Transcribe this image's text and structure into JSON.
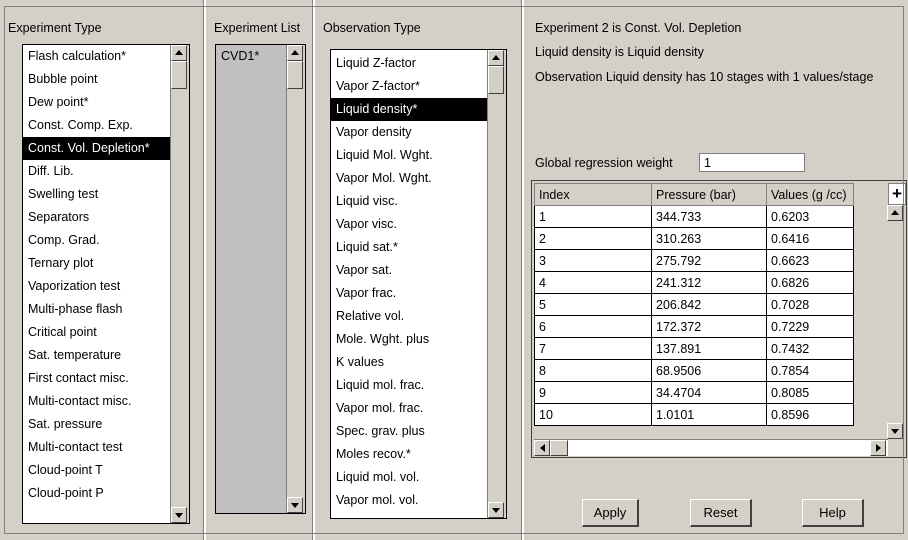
{
  "experiment_type": {
    "title": "Experiment Type",
    "items": [
      "Flash calculation*",
      "Bubble point",
      "Dew point*",
      "Const. Comp. Exp.",
      "Const. Vol. Depletion*",
      "Diff. Lib.",
      "Swelling test",
      "Separators",
      "Comp. Grad.",
      "Ternary plot",
      "Vaporization test",
      "Multi-phase flash",
      "Critical point",
      "Sat. temperature",
      "First contact misc.",
      "Multi-contact misc.",
      "Sat. pressure",
      "Multi-contact test",
      "Cloud-point T",
      "Cloud-point P"
    ],
    "selected": "Const. Vol. Depletion*"
  },
  "experiment_list": {
    "title": "Experiment List",
    "items": [
      "CVD1*"
    ]
  },
  "observation_type": {
    "title": "Observation Type",
    "items": [
      "Liquid Z-factor",
      "Vapor Z-factor*",
      "Liquid density*",
      "Vapor density",
      "Liquid Mol. Wght.",
      "Vapor Mol. Wght.",
      "Liquid visc.",
      "Vapor visc.",
      "Liquid sat.*",
      "Vapor sat.",
      "Vapor frac.",
      "Relative vol.",
      "Mole. Wght. plus",
      "K values",
      "Liquid mol. frac.",
      "Vapor mol. frac.",
      "Spec. grav. plus",
      "Moles recov.*",
      "Liquid mol. vol.",
      "Vapor mol. vol."
    ],
    "selected": "Liquid density*"
  },
  "details": {
    "line1": "Experiment 2 is Const. Vol. Depletion",
    "line2": "Liquid density  is  Liquid density",
    "line3": "Observation Liquid density has 10 stages with 1 values/stage",
    "global_weight_label": "Global regression  weight",
    "global_weight_value": "1"
  },
  "grid": {
    "columns": [
      "Index",
      "Pressure (bar)",
      "Values (g /cc)"
    ],
    "plus": "+",
    "rows": [
      [
        "1",
        "344.733",
        "0.6203"
      ],
      [
        "2",
        "310.263",
        "0.6416"
      ],
      [
        "3",
        "275.792",
        "0.6623"
      ],
      [
        "4",
        "241.312",
        "0.6826"
      ],
      [
        "5",
        "206.842",
        "0.7028"
      ],
      [
        "6",
        "172.372",
        "0.7229"
      ],
      [
        "7",
        "137.891",
        "0.7432"
      ],
      [
        "8",
        "68.9506",
        "0.7854"
      ],
      [
        "9",
        "34.4704",
        "0.8085"
      ],
      [
        "10",
        "1.0101",
        "0.8596"
      ]
    ]
  },
  "buttons": {
    "apply": "Apply",
    "reset": "Reset",
    "help": "Help"
  }
}
